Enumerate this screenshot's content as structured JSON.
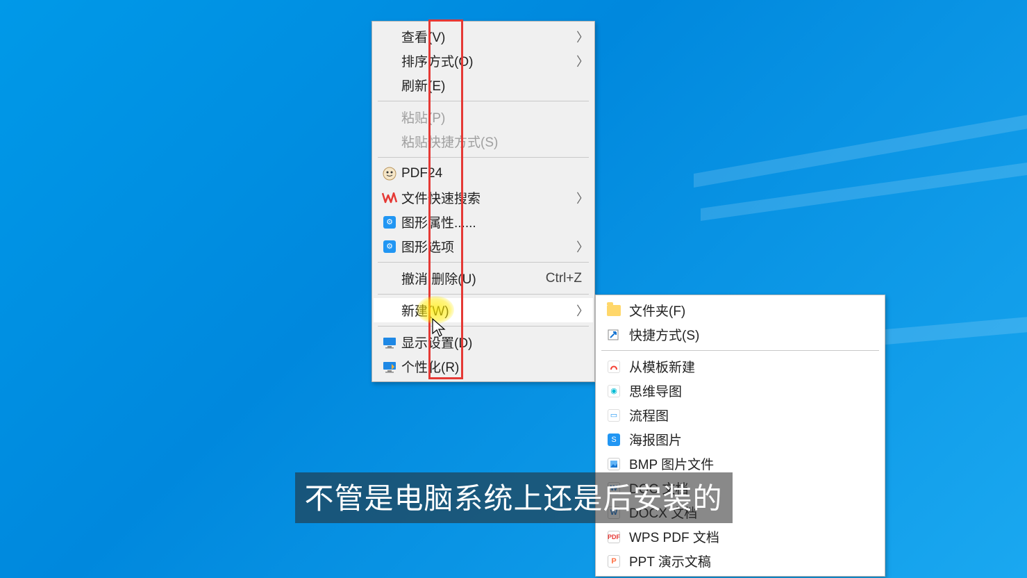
{
  "main_menu": {
    "items": [
      {
        "label": "查看(V)",
        "has_arrow": true
      },
      {
        "label": "排序方式(O)",
        "has_arrow": true
      },
      {
        "label": "刷新(E)"
      },
      {
        "sep": true
      },
      {
        "label": "粘贴(P)",
        "disabled": true
      },
      {
        "label": "粘贴快捷方式(S)",
        "disabled": true
      },
      {
        "sep": true
      },
      {
        "label": "PDF24",
        "icon": "pdf24-icon"
      },
      {
        "label": "文件快速搜索",
        "icon": "wps-search-icon",
        "has_arrow": true
      },
      {
        "label": "图形属性......",
        "icon": "graphics-props-icon"
      },
      {
        "label": "图形选项",
        "icon": "graphics-options-icon",
        "has_arrow": true
      },
      {
        "sep": true
      },
      {
        "label": "撤消 删除(U)",
        "shortcut": "Ctrl+Z"
      },
      {
        "sep": true
      },
      {
        "label": "新建(W)",
        "has_arrow": true,
        "highlighted": true
      },
      {
        "sep": true
      },
      {
        "label": "显示设置(D)",
        "icon": "display-settings-icon"
      },
      {
        "label": "个性化(R)",
        "icon": "personalize-icon"
      }
    ]
  },
  "submenu": {
    "items": [
      {
        "label": "文件夹(F)",
        "icon": "folder-icon"
      },
      {
        "label": "快捷方式(S)",
        "icon": "shortcut-icon"
      },
      {
        "sep": true
      },
      {
        "label": "从模板新建",
        "icon": "template-icon"
      },
      {
        "label": "思维导图",
        "icon": "mindmap-icon"
      },
      {
        "label": "流程图",
        "icon": "flowchart-icon"
      },
      {
        "label": "海报图片",
        "icon": "poster-icon"
      },
      {
        "label": "BMP 图片文件",
        "icon": "bmp-icon"
      },
      {
        "label": "DOC 文档",
        "icon": "doc-icon"
      },
      {
        "label": "DOCX 文档",
        "icon": "docx-icon"
      },
      {
        "label": "WPS PDF 文档",
        "icon": "wps-pdf-icon"
      },
      {
        "label": "PPT 演示文稿",
        "icon": "ppt-icon"
      }
    ]
  },
  "subtitle": "不管是电脑系统上还是后安装的",
  "colors": {
    "menu_bg": "#f0f0f0",
    "submenu_bg": "#ffffff",
    "red_annotation": "#e53935",
    "yellow_highlight": "#ffeb00"
  }
}
